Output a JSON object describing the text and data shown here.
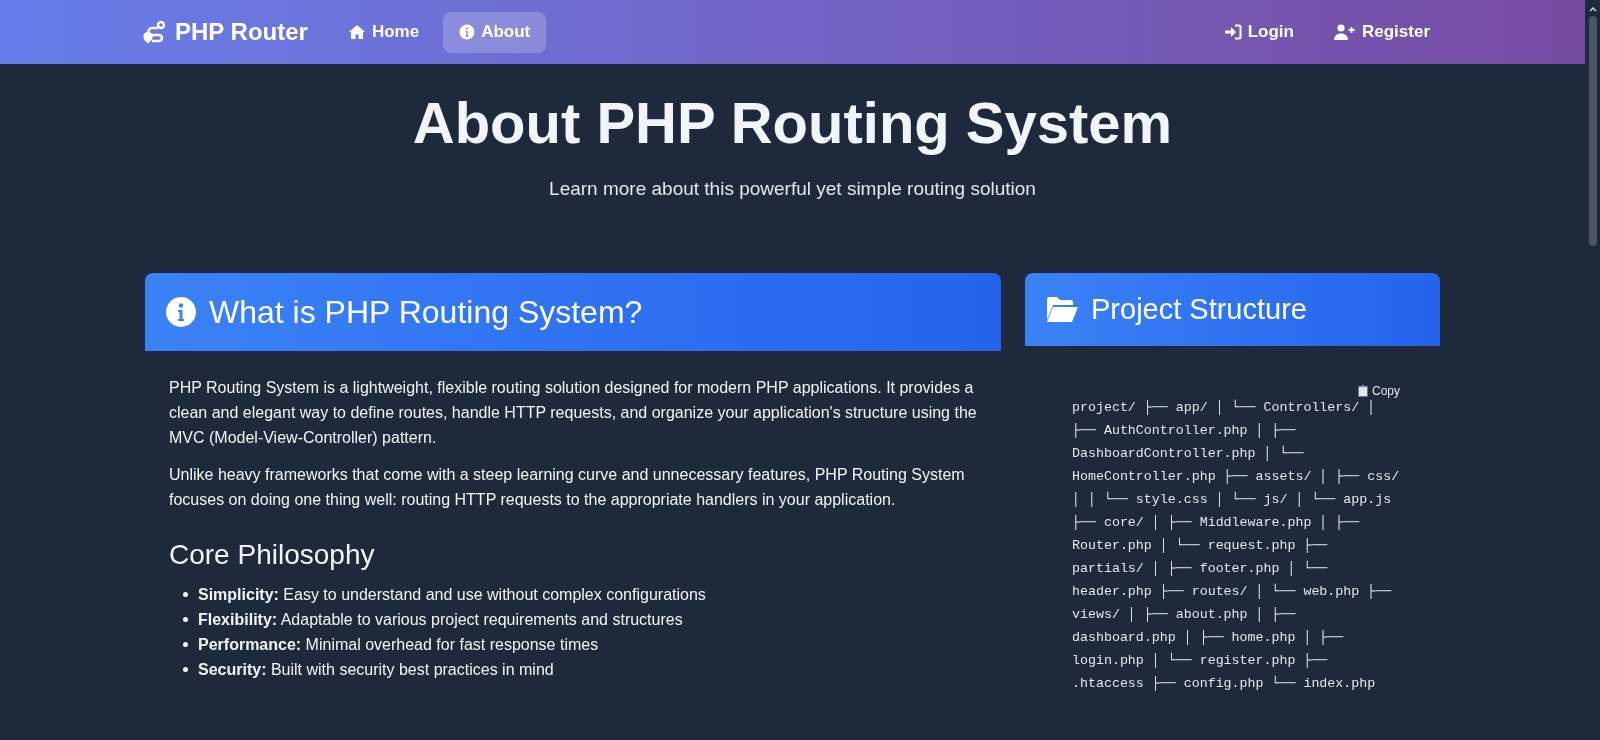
{
  "navbar": {
    "brand": "PHP Router",
    "links": [
      {
        "label": "Home",
        "selected": false
      },
      {
        "label": "About",
        "selected": true
      }
    ],
    "auth_links": [
      {
        "label": "Login"
      },
      {
        "label": "Register"
      }
    ]
  },
  "hero": {
    "title": "About PHP Routing System",
    "subtitle": "Learn more about this powerful yet simple routing solution"
  },
  "about_card": {
    "title": "What is PHP Routing System?",
    "paragraphs": [
      "PHP Routing System is a lightweight, flexible routing solution designed for modern PHP applications. It provides a clean and elegant way to define routes, handle HTTP requests, and organize your application's structure using the MVC (Model-View-Controller) pattern.",
      "Unlike heavy frameworks that come with a steep learning curve and unnecessary features, PHP Routing System focuses on doing one thing well: routing HTTP requests to the appropriate handlers in your application."
    ],
    "section_title": "Core Philosophy",
    "principles": [
      {
        "text": "**Simplicity:** Easy to understand and use without complex configurations"
      },
      {
        "text": "**Flexibility:** Adaptable to various project requirements and structures"
      },
      {
        "text": "**Performance:** Minimal overhead for fast response times"
      },
      {
        "text": "**Security:** Built with security best practices in mind"
      }
    ]
  },
  "structure_card": {
    "title": "Project Structure",
    "copy_button": "Copy",
    "code": "project/ ├── app/ │ └── Controllers/ │ ├── AuthController.php │ ├── DashboardController.php │ └── HomeController.php ├── assets/ │ ├── css/ │ │ └── style.css │ └── js/ │ └── app.js ├── core/ │ ├── Middleware.php │ ├── Router.php │ └── request.php ├── partials/ │ ├── footer.php │ └── header.php ├── routes/ │ └── web.php ├── views/ │ ├── about.php │ ├── dashboard.php │ ├── home.php │ ├── login.php │ └── register.php ├── .htaccess ├── config.php └── index.php"
  }
}
